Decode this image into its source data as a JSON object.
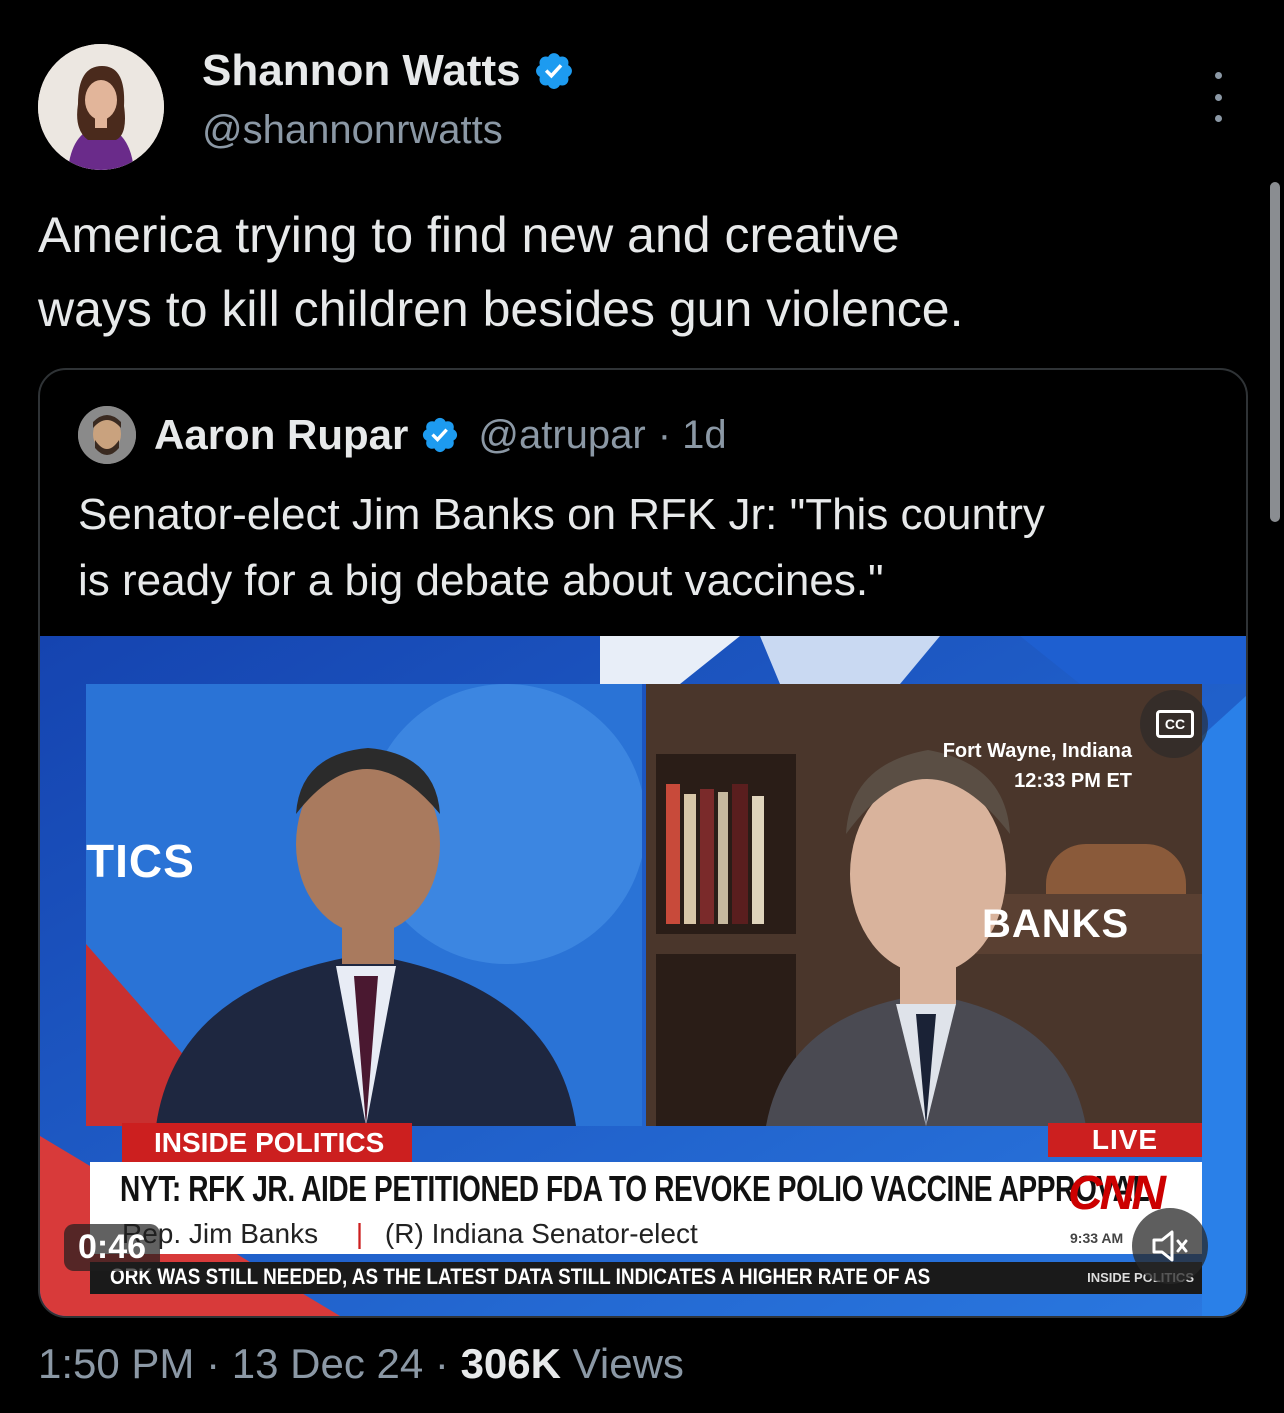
{
  "tweet": {
    "author_name": "Shannon Watts",
    "author_handle": "@shannonrwatts",
    "line1": "America trying to find new and creative",
    "line2": "ways to kill children besides gun violence.",
    "time": "1:50 PM",
    "sep1": "·",
    "date": "13 Dec 24",
    "sep2": "·",
    "views_count": "306K",
    "views_label": "Views"
  },
  "quoted": {
    "author_name": "Aaron Rupar",
    "author_handle": "@atrupar",
    "age": "· 1d",
    "line1": "Senator-elect Jim Banks on RFK Jr: \"This country",
    "line2": "is ready for a big debate about vaccines.\""
  },
  "video": {
    "show_label": "INSIDE POLITICS",
    "live_label": "LIVE",
    "headline": "NYT: RFK JR. AIDE PETITIONED FDA TO REVOKE POLIO VACCINE APPROVAL",
    "subline_name": "Rep. Jim Banks",
    "subline_sep": "|",
    "subline_role": "(R) Indiana Senator-elect",
    "crawl": "ORK WAS STILL NEEDED, AS THE LATEST DATA STILL INDICATES A HIGHER RATE OF AS",
    "crawl_tag": "INSIDE POLITICS",
    "network": "CNN",
    "local_time": "9:33 AM",
    "location_line1": "Fort Wayne, Indiana",
    "location_line2": "12:33 PM ET",
    "backdrop_text": "TICS",
    "banks_text": "BANKS",
    "cc_label": "CC",
    "elapsed": "0:46"
  },
  "colors": {
    "background": "#000000",
    "verified": "#1d9bf0",
    "muted_text": "#8b98a5",
    "cnn_red": "#cc1f1f"
  },
  "icons": {
    "verified": "verified-badge-icon",
    "more": "more-options-icon",
    "mute": "speaker-muted-icon",
    "captions": "closed-captions-icon"
  }
}
